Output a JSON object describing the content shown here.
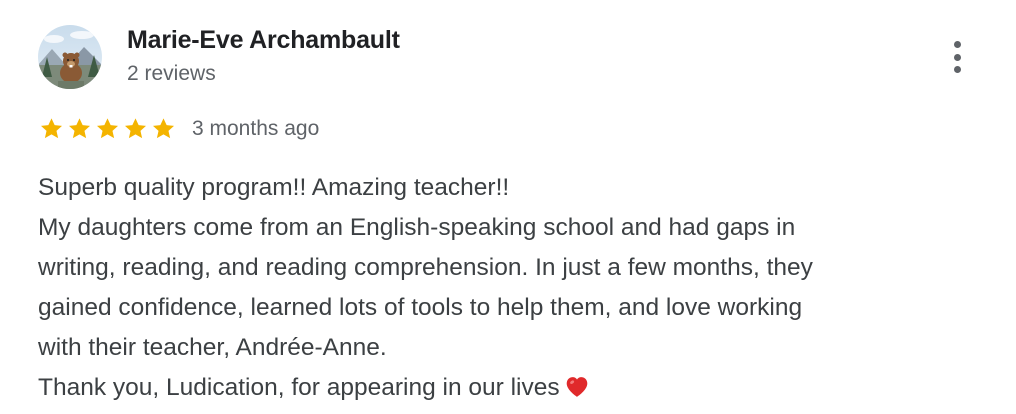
{
  "review": {
    "author_name": "Marie-Eve Archambault",
    "review_count": "2 reviews",
    "rating": 5,
    "rating_max": 5,
    "time_ago": "3 months ago",
    "text_lines": [
      "Superb quality program!! Amazing teacher!!",
      "My daughters come from an English-speaking school and had gaps in",
      "writing, reading, and reading comprehension. In just a few months, they",
      "gained confidence, learned lots of tools to help them, and love working",
      "with their teacher, Andrée-Anne.",
      "Thank you, Ludication, for appearing in our lives"
    ],
    "trailing_emoji": "heart-emoji"
  },
  "icons": {
    "star_color": "#f4b400",
    "heart_color": "#e0292b",
    "more_menu": "more-vert-icon"
  }
}
